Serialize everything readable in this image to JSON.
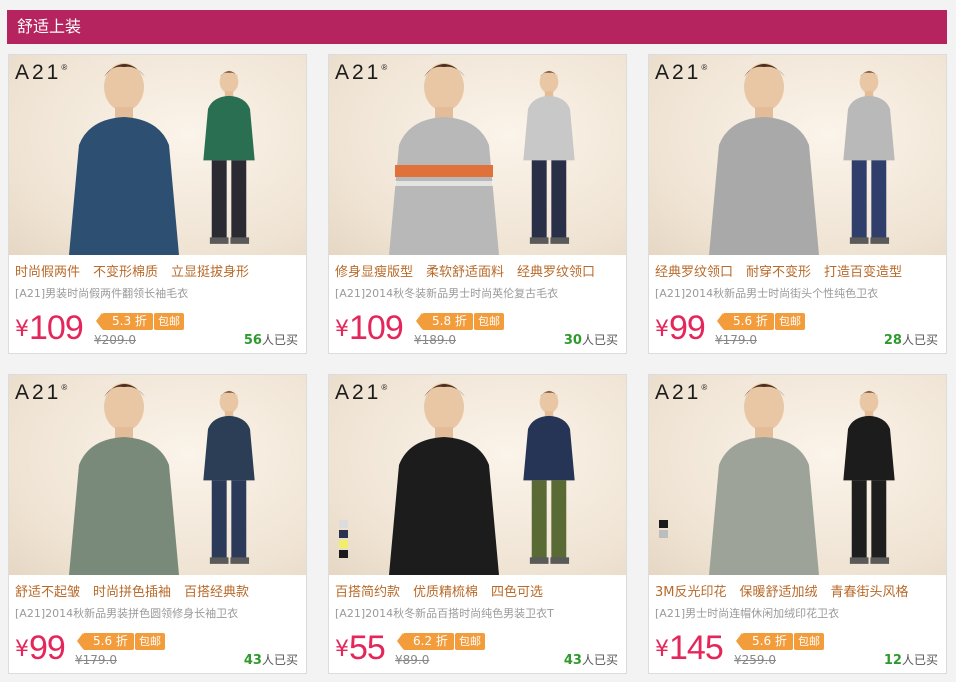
{
  "section": {
    "title": "舒适上装"
  },
  "brand": {
    "logo": "A21",
    "registered": "®"
  },
  "products": [
    {
      "features": [
        "时尚假两件",
        "不变形棉质",
        "立显挺拔身形"
      ],
      "title": "[A21]男装时尚假两件翻领长袖毛衣",
      "currency": "¥",
      "price": "109",
      "discount": "5.3 折",
      "shipping": "包邮",
      "original_price": "¥209.0",
      "sold_count": "56",
      "sold_suffix": "人已买",
      "colors": {
        "top": "#2d4f72",
        "side_top": "#2a6f52",
        "pants": "#2b2a33"
      }
    },
    {
      "features": [
        "修身显瘦版型",
        "柔软舒适面料",
        "经典罗纹领口"
      ],
      "title": "[A21]2014秋冬装新品男士时尚英伦复古毛衣",
      "currency": "¥",
      "price": "109",
      "discount": "5.8 折",
      "shipping": "包邮",
      "original_price": "¥189.0",
      "sold_count": "30",
      "sold_suffix": "人已买",
      "colors": {
        "top": "#b8b8b8",
        "side_top": "#c8c8c8",
        "pants": "#2a2f48",
        "accent": "#e0713a"
      }
    },
    {
      "features": [
        "经典罗纹领口",
        "耐穿不变形",
        "打造百变造型"
      ],
      "title": "[A21]2014秋新品男士时尚街头个性纯色卫衣",
      "currency": "¥",
      "price": "99",
      "discount": "5.6 折",
      "shipping": "包邮",
      "original_price": "¥179.0",
      "sold_count": "28",
      "sold_suffix": "人已买",
      "colors": {
        "top": "#a9a9a9",
        "side_top": "#b9b9b9",
        "pants": "#2f3e6a"
      }
    },
    {
      "features": [
        "舒适不起皱",
        "时尚拼色插袖",
        "百搭经典款"
      ],
      "title": "[A21]2014秋新品男装拼色圆领修身长袖卫衣",
      "currency": "¥",
      "price": "99",
      "discount": "5.6 折",
      "shipping": "包邮",
      "original_price": "¥179.0",
      "sold_count": "43",
      "sold_suffix": "人已买",
      "colors": {
        "top": "#7a8a7a",
        "side_top": "#2c3d56",
        "pants": "#2c3a5a"
      }
    },
    {
      "features": [
        "百搭简约款",
        "优质精梳棉",
        "四色可选"
      ],
      "title": "[A21]2014秋冬新品百搭时尚纯色男装卫衣T",
      "currency": "¥",
      "price": "55",
      "discount": "6.2 折",
      "shipping": "包邮",
      "original_price": "¥89.0",
      "sold_count": "43",
      "sold_suffix": "人已买",
      "colors": {
        "top": "#1c1c1c",
        "side_top": "#263556",
        "pants": "#5a6a34"
      },
      "swatches": [
        "#dcdcdc",
        "#2b3150",
        "#f1ee6a",
        "#1a1a1a"
      ]
    },
    {
      "features": [
        "3M反光印花",
        "保暖舒适加绒",
        "青春街头风格"
      ],
      "title": "[A21]男士时尚连帽休闲加绒印花卫衣",
      "currency": "¥",
      "price": "145",
      "discount": "5.6 折",
      "shipping": "包邮",
      "original_price": "¥259.0",
      "sold_count": "12",
      "sold_suffix": "人已买",
      "colors": {
        "top": "#9ea39a",
        "side_top": "#1c1c1c",
        "pants": "#1e1e1e"
      },
      "swatches": [
        "#1a1a1a",
        "#bdbdbd"
      ]
    }
  ]
}
